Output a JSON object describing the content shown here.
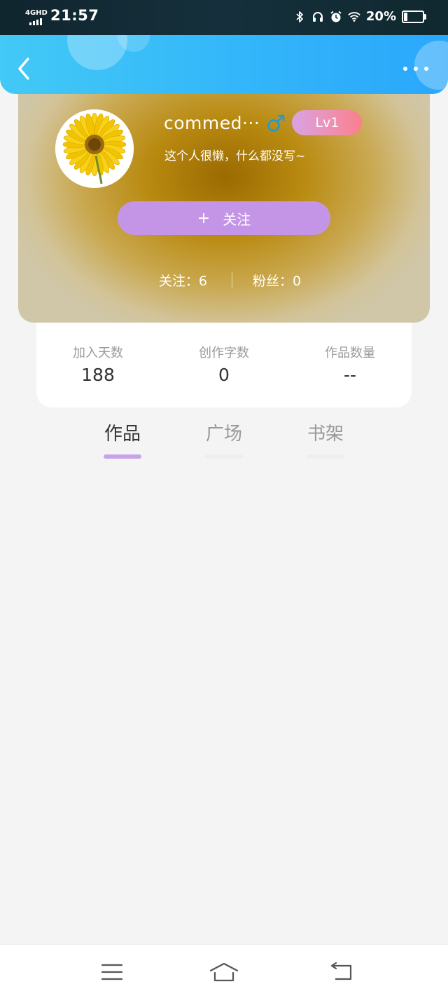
{
  "status_bar": {
    "network": "4GHD",
    "time": "21:57",
    "battery": "20%",
    "battery_level": 0.2,
    "icons": [
      "bluetooth-icon",
      "headphones-icon",
      "alarm-icon",
      "wifi-icon"
    ]
  },
  "header": {
    "back_icon": "chevron-left-icon",
    "more_icon": "more-dots-icon",
    "colors": {
      "start": "#43c9f6",
      "end": "#2aa7fb"
    }
  },
  "profile": {
    "avatar": "sunflower-avatar",
    "username": "commed···",
    "gender_icon": "male-icon",
    "level": "Lv1",
    "bio": "这个人很懒，什么都没写~",
    "follow_button": {
      "plus": "+",
      "label": "关注"
    },
    "following": "关注：6",
    "fans": "粉丝：0"
  },
  "stats": [
    {
      "label": "加入天数",
      "value": "188"
    },
    {
      "label": "创作字数",
      "value": "0"
    },
    {
      "label": "作品数量",
      "value": "--"
    }
  ],
  "tabs": [
    {
      "label": "作品",
      "active": true
    },
    {
      "label": "广场",
      "active": false
    },
    {
      "label": "书架",
      "active": false
    }
  ],
  "accent_colors": {
    "tab_active_text": "#333333",
    "tab_inactive_text": "#999999",
    "tab_active_underline": "#c9a3ea",
    "tab_inactive_underline": "#eeeeee",
    "follow_button": "#c495e6"
  },
  "nav_bar": {
    "icons": [
      "menu-icon",
      "home-icon",
      "back-icon"
    ]
  }
}
